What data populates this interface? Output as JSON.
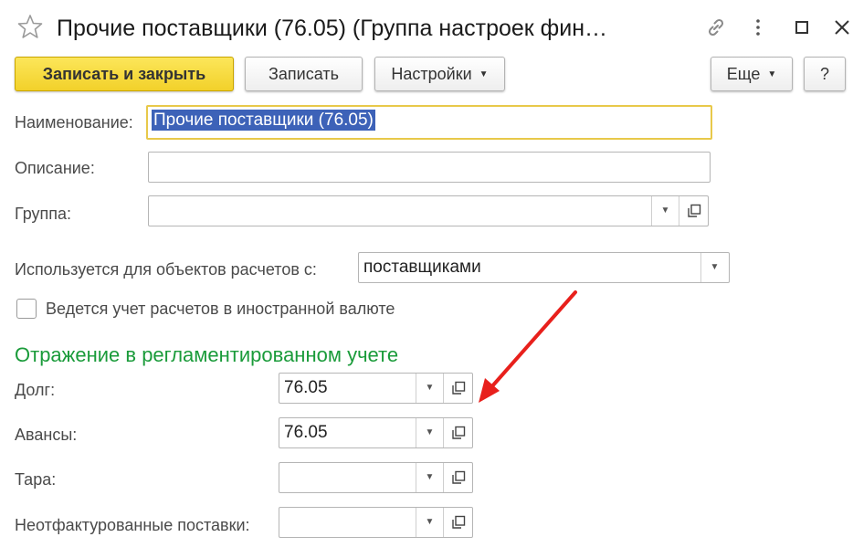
{
  "window": {
    "title": "Прочие поставщики (76.05) (Группа настроек фин…"
  },
  "toolbar": {
    "save_close_label": "Записать и закрыть",
    "save_label": "Записать",
    "settings_label": "Настройки",
    "more_label": "Еще",
    "help_label": "?"
  },
  "form": {
    "name_label": "Наименование:",
    "name_value": "Прочие поставщики (76.05)",
    "description_label": "Описание:",
    "description_value": "",
    "group_label": "Группа:",
    "group_value": "",
    "used_for_label": "Используется для объектов расчетов с:",
    "used_for_value": "поставщиками",
    "foreign_currency_label": "Ведется учет расчетов в иностранной валюте",
    "foreign_currency_checked": false
  },
  "reg_accounting": {
    "section_title": "Отражение в регламентированном учете",
    "debt_label": "Долг:",
    "debt_value": "76.05",
    "advances_label": "Авансы:",
    "advances_value": "76.05",
    "container_label": "Тара:",
    "container_value": "",
    "uninvoiced_label": "Неотфактурованные поставки:",
    "uninvoiced_value": ""
  },
  "colors": {
    "primary_button": "#f2d12a",
    "section_title": "#1a9b3a",
    "selection": "#3d62b8",
    "annotation_arrow": "#e8201c"
  }
}
